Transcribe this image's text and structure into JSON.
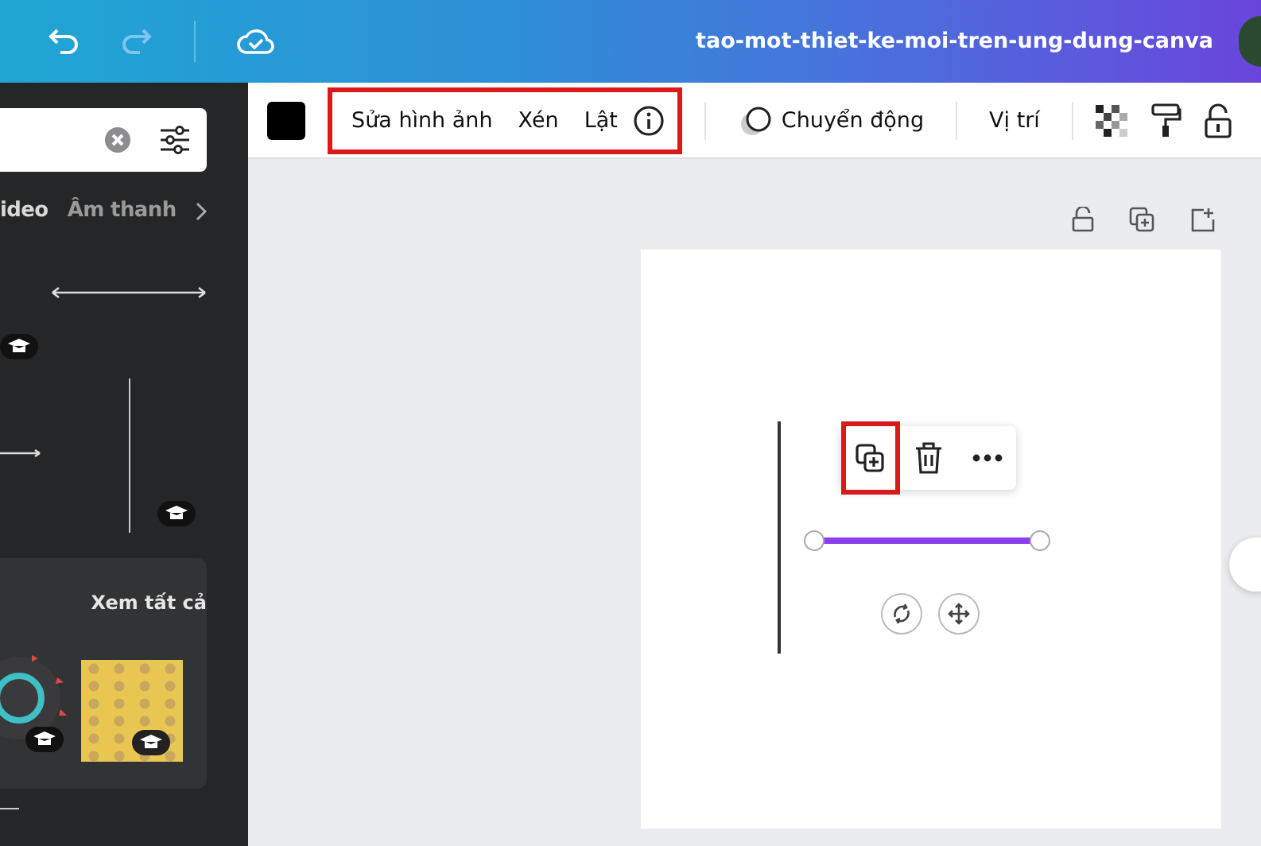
{
  "top_bar": {
    "title": "tao-mot-thiet-ke-moi-tren-ung-dung-canva"
  },
  "side_panel": {
    "tabs": [
      {
        "label": "ideo"
      },
      {
        "label": "Âm thanh"
      }
    ],
    "see_all": "Xem tất cả"
  },
  "toolbar": {
    "highlighted": true,
    "items": [
      {
        "label": "Sửa hình ảnh"
      },
      {
        "label": "Xén"
      },
      {
        "label": "Lật"
      }
    ],
    "motion": "Chuyển động",
    "position": "Vị trí"
  },
  "element_menu": {
    "duplicate_highlighted": true
  }
}
